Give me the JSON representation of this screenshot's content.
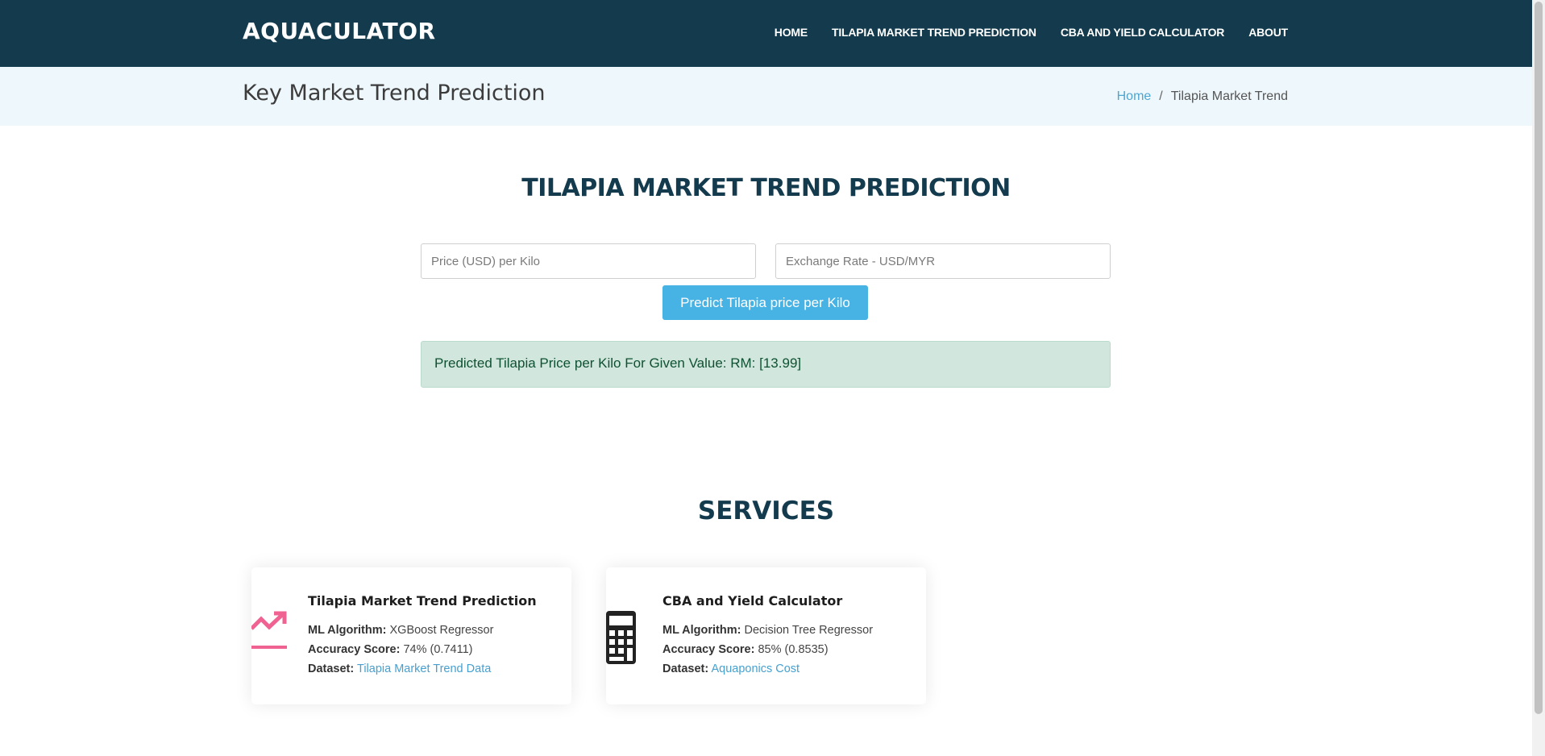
{
  "header": {
    "brand": "AQUACULATOR",
    "nav": [
      "HOME",
      "TILAPIA MARKET TREND PREDICTION",
      "CBA AND YIELD CALCULATOR",
      "ABOUT"
    ]
  },
  "breadcrumb_band": {
    "title": "Key Market Trend Prediction",
    "home_link": "Home",
    "separator": "/",
    "current": "Tilapia Market Trend"
  },
  "main": {
    "title": "TILAPIA MARKET TREND PREDICTION",
    "price_input": {
      "placeholder": "Price (USD) per Kilo",
      "value": ""
    },
    "rate_input": {
      "placeholder": "Exchange Rate - USD/MYR",
      "value": ""
    },
    "predict_button": "Predict Tilapia price per Kilo",
    "result": "Predicted Tilapia Price per Kilo For Given Value: RM: [13.99]"
  },
  "services": {
    "title": "SERVICES",
    "cards": [
      {
        "title": "Tilapia Market Trend Prediction",
        "icon": "trend-up-icon",
        "algo_label": "ML Algorithm:",
        "algo_value": "XGBoost Regressor",
        "acc_label": "Accuracy Score:",
        "acc_value": "74% (0.7411)",
        "dataset_label": "Dataset:",
        "dataset_link": "Tilapia Market Trend Data"
      },
      {
        "title": "CBA and Yield Calculator",
        "icon": "calculator-icon",
        "algo_label": "ML Algorithm:",
        "algo_value": "Decision Tree Regressor",
        "acc_label": "Accuracy Score:",
        "acc_value": "85% (0.8535)",
        "dataset_label": "Dataset:",
        "dataset_link": "Aquaponics Cost"
      }
    ]
  },
  "colors": {
    "header_bg": "#133b4d",
    "breadcrumb_bg": "#eef7fb",
    "accent": "#47b2e4",
    "success_bg": "#d1e7dd",
    "trend_icon": "#f06292"
  }
}
